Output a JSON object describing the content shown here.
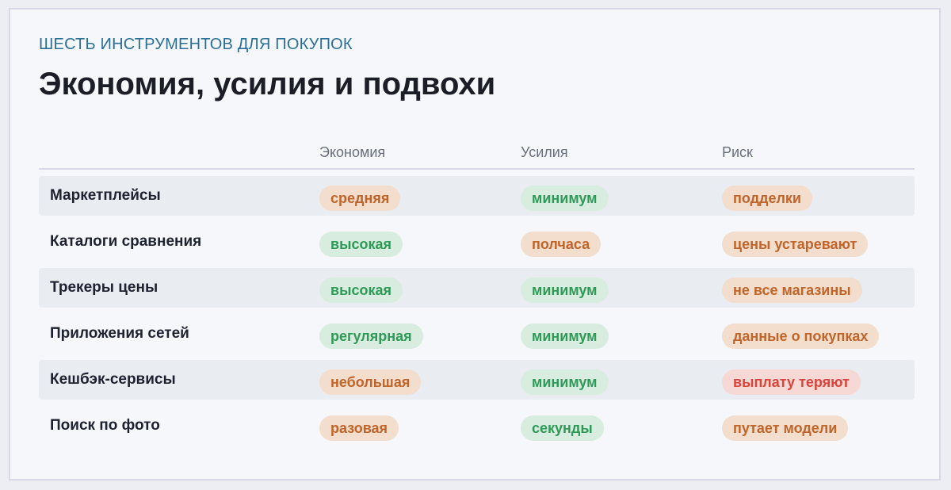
{
  "header": {
    "eyebrow": "ШЕСТЬ ИНСТРУМЕНТОВ ДЛЯ ПОКУПОК",
    "title": "Экономия, усилия и подвохи"
  },
  "columns": [
    "Экономия",
    "Усилия",
    "Риск"
  ],
  "rows": [
    {
      "tool": "Маркетплейсы",
      "savings": "средняя",
      "effort": "минимум",
      "risk": "подделки",
      "savings_level": "mid",
      "effort_level": "good",
      "risk_level": "mid"
    },
    {
      "tool": "Каталоги сравнения",
      "savings": "высокая",
      "effort": "полчаса",
      "risk": "цены устаревают",
      "savings_level": "good",
      "effort_level": "mid",
      "risk_level": "mid"
    },
    {
      "tool": "Трекеры цены",
      "savings": "высокая",
      "effort": "минимум",
      "risk": "не все магазины",
      "savings_level": "good",
      "effort_level": "good",
      "risk_level": "mid"
    },
    {
      "tool": "Приложения сетей",
      "savings": "регулярная",
      "effort": "минимум",
      "risk": "данные о покупках",
      "savings_level": "good",
      "effort_level": "good",
      "risk_level": "mid"
    },
    {
      "tool": "Кешбэк-сервисы",
      "savings": "небольшая",
      "effort": "минимум",
      "risk": "выплату теряют",
      "savings_level": "mid",
      "effort_level": "good",
      "risk_level": "bad"
    },
    {
      "tool": "Поиск по фото",
      "savings": "разовая",
      "effort": "секунды",
      "risk": "путает модели",
      "savings_level": "mid",
      "effort_level": "good",
      "risk_level": "mid"
    }
  ],
  "colors": {
    "good_text": "#2f9a57",
    "good_bg": "#d8eddf",
    "mid_text": "#c0652a",
    "mid_bg": "#f3ddcd",
    "bad_text": "#d9443b",
    "bad_bg": "#f6d8d5",
    "eyebrow": "#2b6f96"
  }
}
